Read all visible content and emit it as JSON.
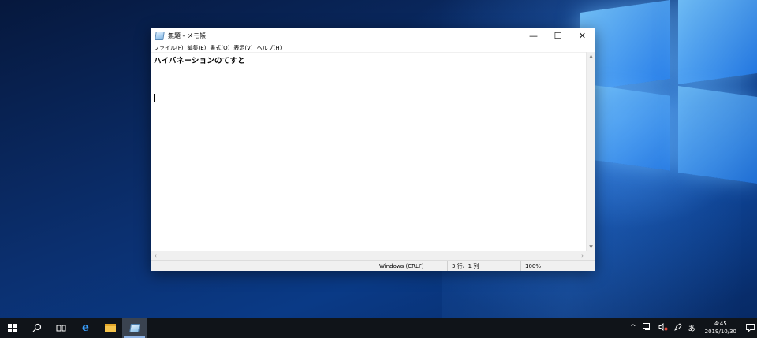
{
  "window": {
    "title": "無題 - メモ帳",
    "controls": {
      "minimize": "—",
      "maximize": "☐",
      "close": "✕"
    }
  },
  "menu": [
    "ファイル(F)",
    "編集(E)",
    "書式(O)",
    "表示(V)",
    "ヘルプ(H)"
  ],
  "editor": {
    "text": "ハイバネーションのてすと"
  },
  "status": {
    "encoding": "Windows (CRLF)",
    "position": "3 行、1 列",
    "zoom": "100%"
  },
  "taskbar": {
    "clock_time": "4:45",
    "clock_date": "2019/10/30",
    "ime": "あ"
  }
}
